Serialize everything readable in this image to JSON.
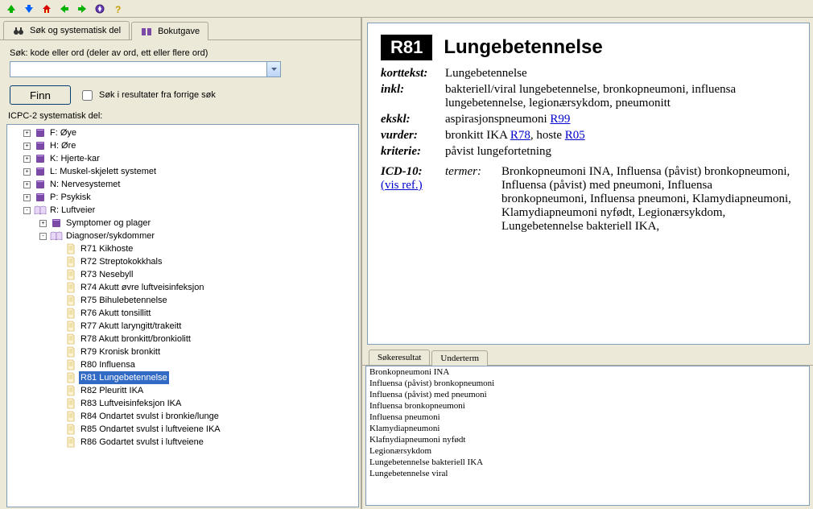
{
  "toolbar_icons": [
    "up",
    "down",
    "home",
    "back",
    "forward",
    "compass",
    "help"
  ],
  "tabs": {
    "search_tab": "Søk og systematisk del",
    "book_tab": "Bokutgave"
  },
  "search": {
    "label": "Søk: kode eller ord (deler av ord, ett eller flere ord)",
    "value": "",
    "find_button": "Finn",
    "checkbox_label": "Søk i resultater fra forrige søk"
  },
  "tree_section_label": "ICPC-2 systematisk del:",
  "tree": [
    {
      "lv": 1,
      "exp": "+",
      "icon": "book",
      "text": "F: Øye"
    },
    {
      "lv": 1,
      "exp": "+",
      "icon": "book",
      "text": "H: Øre"
    },
    {
      "lv": 1,
      "exp": "+",
      "icon": "book",
      "text": "K: Hjerte-kar"
    },
    {
      "lv": 1,
      "exp": "+",
      "icon": "book",
      "text": "L: Muskel-skjelett systemet"
    },
    {
      "lv": 1,
      "exp": "+",
      "icon": "book",
      "text": "N: Nervesystemet"
    },
    {
      "lv": 1,
      "exp": "+",
      "icon": "book",
      "text": "P: Psykisk"
    },
    {
      "lv": 1,
      "exp": "-",
      "icon": "book-open",
      "text": "R: Luftveier"
    },
    {
      "lv": 2,
      "exp": "+",
      "icon": "book",
      "text": "Symptomer og plager"
    },
    {
      "lv": 2,
      "exp": "-",
      "icon": "book-open",
      "text": "Diagnoser/sykdommer"
    },
    {
      "lv": 3,
      "exp": "",
      "icon": "page",
      "text": "R71 Kikhoste"
    },
    {
      "lv": 3,
      "exp": "",
      "icon": "page",
      "text": "R72 Streptokokkhals"
    },
    {
      "lv": 3,
      "exp": "",
      "icon": "page",
      "text": "R73 Nesebyll"
    },
    {
      "lv": 3,
      "exp": "",
      "icon": "page",
      "text": "R74 Akutt øvre luftveisinfeksjon"
    },
    {
      "lv": 3,
      "exp": "",
      "icon": "page",
      "text": "R75 Bihulebetennelse"
    },
    {
      "lv": 3,
      "exp": "",
      "icon": "page",
      "text": "R76 Akutt tonsillitt"
    },
    {
      "lv": 3,
      "exp": "",
      "icon": "page",
      "text": "R77 Akutt laryngitt/trakeitt"
    },
    {
      "lv": 3,
      "exp": "",
      "icon": "page",
      "text": "R78 Akutt bronkitt/bronkiolitt"
    },
    {
      "lv": 3,
      "exp": "",
      "icon": "page",
      "text": "R79 Kronisk bronkitt"
    },
    {
      "lv": 3,
      "exp": "",
      "icon": "page",
      "text": "R80 Influensa"
    },
    {
      "lv": 3,
      "exp": "",
      "icon": "page",
      "text": "R81 Lungebetennelse",
      "sel": true
    },
    {
      "lv": 3,
      "exp": "",
      "icon": "page",
      "text": "R82 Pleuritt IKA"
    },
    {
      "lv": 3,
      "exp": "",
      "icon": "page",
      "text": "R83 Luftveisinfeksjon IKA"
    },
    {
      "lv": 3,
      "exp": "",
      "icon": "page",
      "text": "R84 Ondartet svulst i bronkie/lunge"
    },
    {
      "lv": 3,
      "exp": "",
      "icon": "page",
      "text": "R85 Ondartet svulst i luftveiene IKA"
    },
    {
      "lv": 3,
      "exp": "",
      "icon": "page",
      "text": "R86 Godartet svulst i luftveiene"
    }
  ],
  "detail": {
    "code": "R81",
    "title": "Lungebetennelse",
    "rows": {
      "korttekst_label": "korttekst:",
      "korttekst": "Lungebetennelse",
      "inkl_label": "inkl:",
      "inkl": "bakteriell/viral lungebetennelse, bronkopneumoni, influensa lungebetennelse, legionærsykdom, pneumonitt",
      "ekskl_label": "ekskl:",
      "ekskl_pre": "aspirasjonspneumoni ",
      "ekskl_link": "R99",
      "vurder_label": "vurder:",
      "vurder_pre1": "bronkitt IKA ",
      "vurder_link1": "R78",
      "vurder_mid": ", hoste ",
      "vurder_link2": "R05",
      "kriterie_label": "kriterie:",
      "kriterie": "påvist lungefortetning",
      "icd_label": "ICD-10:",
      "icd_vis": "(vis ref.)",
      "icd_sub": "termer:",
      "icd_terms": "Bronkopneumoni INA, Influensa (påvist) bronkopneumoni, Influensa (påvist) med pneumoni, Influensa bronkopneumoni, Influensa pneumoni, Klamydiapneumoni, Klamydiapneumoni nyfødt, Legionærsykdom, Lungebetennelse bakteriell IKA,"
    }
  },
  "result_tabs": {
    "search_results": "Søkeresultat",
    "subterms": "Underterm"
  },
  "subterm_list": [
    "Bronkopneumoni INA",
    "Influensa (påvist) bronkopneumoni",
    "Influensa (påvist) med pneumoni",
    "Influensa bronkopneumoni",
    "Influensa pneumoni",
    "Klamydiapneumoni",
    "Klafnydiapneumoni nyfødt",
    "Legionærsykdom",
    "Lungebetennelse bakteriell IKA",
    "Lungebetennelse viral"
  ]
}
